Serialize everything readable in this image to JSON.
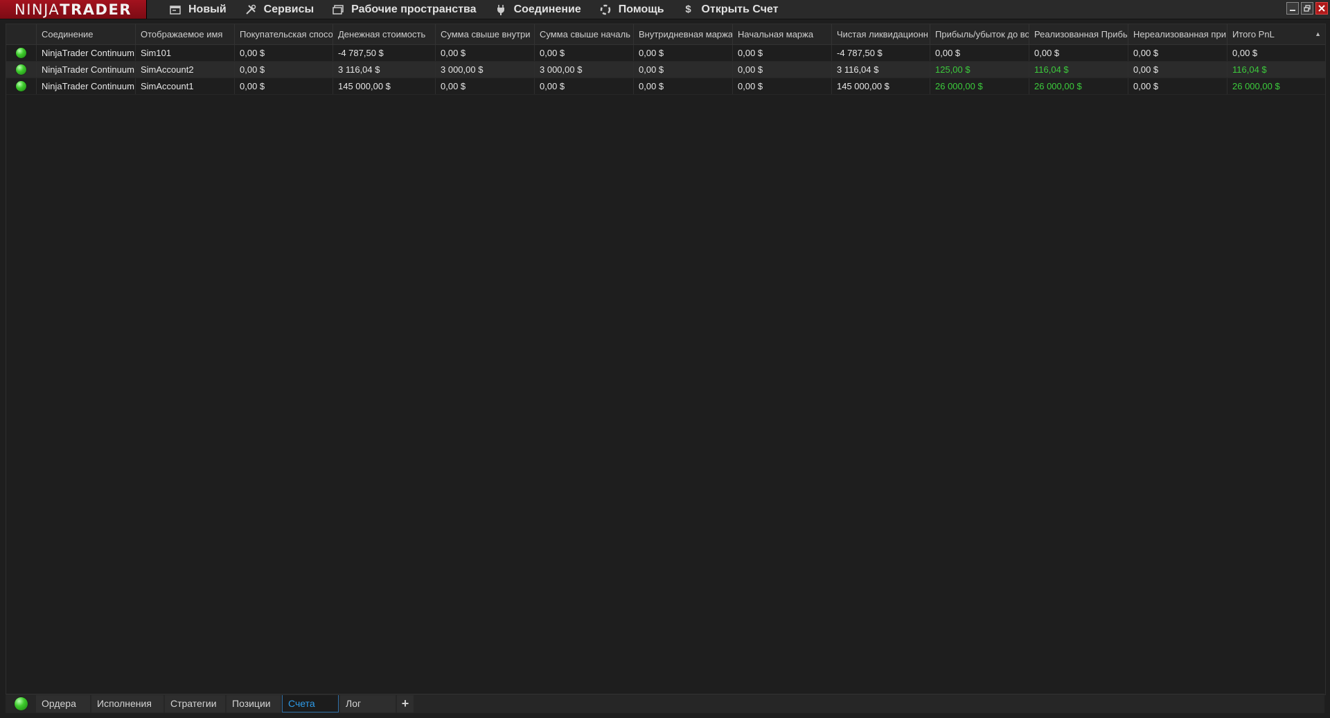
{
  "app": {
    "logo_left": "NINJA",
    "logo_right": "TRADER"
  },
  "menu": [
    {
      "label": "Новый",
      "icon": "new-window-icon"
    },
    {
      "label": "Сервисы",
      "icon": "tools-icon"
    },
    {
      "label": "Рабочие пространства",
      "icon": "workspaces-icon"
    },
    {
      "label": "Соединение",
      "icon": "plug-icon"
    },
    {
      "label": "Помощь",
      "icon": "help-lifebuoy-icon"
    },
    {
      "label": "Открыть Счет",
      "icon": "dollar-icon"
    }
  ],
  "grid": {
    "columns": [
      "Соединение",
      "Отображаемое имя",
      "Покупательская спосо",
      "Денежная стоимость",
      "Сумма свыше внутри",
      "Сумма свыше началь",
      "Внутридневная маржа",
      "Начальная маржа",
      "Чистая ликвидационн",
      "Прибыль/убыток до во",
      "Реализованная Прибы",
      "Нереализованная при",
      "Итого PnL"
    ],
    "rows": [
      {
        "status_color": "#3ecb2c",
        "cells": [
          "NinjaTrader Continuum",
          "Sim101",
          "0,00 $",
          "-4 787,50 $",
          "0,00 $",
          "0,00 $",
          "0,00 $",
          "0,00 $",
          "-4 787,50 $",
          "0,00 $",
          "0,00 $",
          "0,00 $",
          "0,00 $"
        ]
      },
      {
        "status_color": "#3ecb2c",
        "cells": [
          "NinjaTrader Continuum",
          "SimAccount2",
          "0,00 $",
          "3 116,04 $",
          "3 000,00 $",
          "3 000,00 $",
          "0,00 $",
          "0,00 $",
          "3 116,04 $",
          "125,00 $",
          "116,04 $",
          "0,00 $",
          "116,04 $"
        ]
      },
      {
        "status_color": "#3ecb2c",
        "cells": [
          "NinjaTrader Continuum",
          "SimAccount1",
          "0,00 $",
          "145 000,00 $",
          "0,00 $",
          "0,00 $",
          "0,00 $",
          "0,00 $",
          "145 000,00 $",
          "26 000,00 $",
          "26 000,00 $",
          "0,00 $",
          "26 000,00 $"
        ]
      }
    ],
    "positive_color": "#3ccb3c"
  },
  "tabs": [
    {
      "label": "Ордера"
    },
    {
      "label": "Исполнения"
    },
    {
      "label": "Стратегии"
    },
    {
      "label": "Позиции"
    },
    {
      "label": "Счета",
      "active": true
    },
    {
      "label": "Лог"
    }
  ],
  "tab_add_label": "+"
}
